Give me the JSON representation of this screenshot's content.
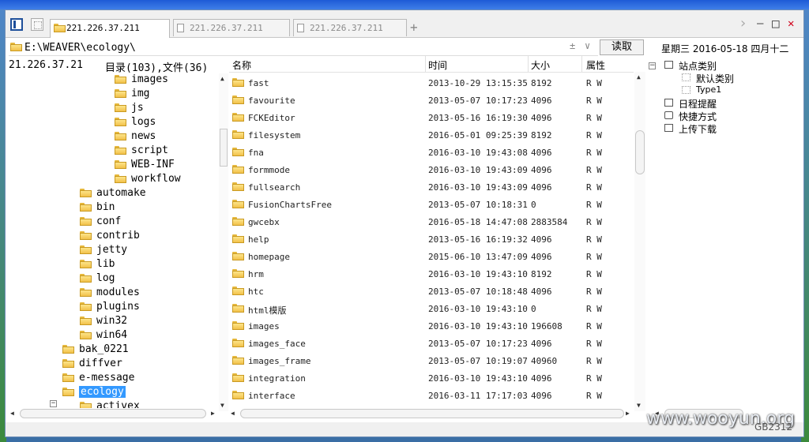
{
  "tabs": [
    {
      "label": "221.226.37.211",
      "active": true
    },
    {
      "label": "221.226.37.211",
      "active": false
    },
    {
      "label": "221.226.37.211",
      "active": false
    }
  ],
  "tab_add": "+",
  "address": {
    "path": "E:\\WEAVER\\ecology\\",
    "plus_minus": "±",
    "dropdown": "∨",
    "read_button": "读取"
  },
  "date_line": "星期三  2016-05-18  四月十二",
  "tree_header": {
    "ip": "21.226.37.21",
    "summary": "目录(103),文件(36)"
  },
  "tree": {
    "level3": [
      "images",
      "img",
      "js",
      "logs",
      "news",
      "script",
      "WEB-INF",
      "workflow"
    ],
    "level2": [
      "automake",
      "bin",
      "conf",
      "contrib",
      "jetty",
      "lib",
      "log",
      "modules",
      "plugins",
      "win32",
      "win64"
    ],
    "level1": [
      "bak_0221",
      "diffver",
      "e-message",
      "ecology"
    ],
    "child": "activex"
  },
  "columns": {
    "name": "名称",
    "time": "时间",
    "size": "大小",
    "attr": "属性"
  },
  "files": [
    {
      "name": "fast",
      "time": "2013-10-29 13:15:35",
      "size": "8192",
      "attr": "R W"
    },
    {
      "name": "favourite",
      "time": "2013-05-07 10:17:23",
      "size": "4096",
      "attr": "R W"
    },
    {
      "name": "FCKEditor",
      "time": "2013-05-16 16:19:30",
      "size": "4096",
      "attr": "R W"
    },
    {
      "name": "filesystem",
      "time": "2016-05-01 09:25:39",
      "size": "8192",
      "attr": "R W"
    },
    {
      "name": "fna",
      "time": "2016-03-10 19:43:08",
      "size": "4096",
      "attr": "R W"
    },
    {
      "name": "formmode",
      "time": "2016-03-10 19:43:09",
      "size": "4096",
      "attr": "R W"
    },
    {
      "name": "fullsearch",
      "time": "2016-03-10 19:43:09",
      "size": "4096",
      "attr": "R W"
    },
    {
      "name": "FusionChartsFree",
      "time": "2013-05-07 10:18:31",
      "size": "0",
      "attr": "R W"
    },
    {
      "name": "gwcebx",
      "time": "2016-05-18 14:47:08",
      "size": "2883584",
      "attr": "R W"
    },
    {
      "name": "help",
      "time": "2013-05-16 16:19:32",
      "size": "4096",
      "attr": "R W"
    },
    {
      "name": "homepage",
      "time": "2015-06-10 13:47:09",
      "size": "4096",
      "attr": "R W"
    },
    {
      "name": "hrm",
      "time": "2016-03-10 19:43:10",
      "size": "8192",
      "attr": "R W"
    },
    {
      "name": "htc",
      "time": "2013-05-07 10:18:48",
      "size": "4096",
      "attr": "R W"
    },
    {
      "name": "html模版",
      "time": "2016-03-10 19:43:10",
      "size": "0",
      "attr": "R W"
    },
    {
      "name": "images",
      "time": "2016-03-10 19:43:10",
      "size": "196608",
      "attr": "R W"
    },
    {
      "name": "images_face",
      "time": "2013-05-07 10:17:23",
      "size": "4096",
      "attr": "R W"
    },
    {
      "name": "images_frame",
      "time": "2013-05-07 10:19:07",
      "size": "40960",
      "attr": "R W"
    },
    {
      "name": "integration",
      "time": "2016-03-10 19:43:10",
      "size": "4096",
      "attr": "R W"
    },
    {
      "name": "interface",
      "time": "2016-03-11 17:17:03",
      "size": "4096",
      "attr": "R W"
    }
  ],
  "right_panel": {
    "root": "站点类别",
    "children": [
      "默认类别",
      "Type1"
    ],
    "items": [
      "日程提醒",
      "快捷方式",
      "上传下载"
    ],
    "expander": "−"
  },
  "window_controls": {
    "next": "›",
    "minimize": "–",
    "maximize": "□",
    "close": "✕"
  },
  "watermark": "www.wooyun.org",
  "encoding": "GB2312"
}
